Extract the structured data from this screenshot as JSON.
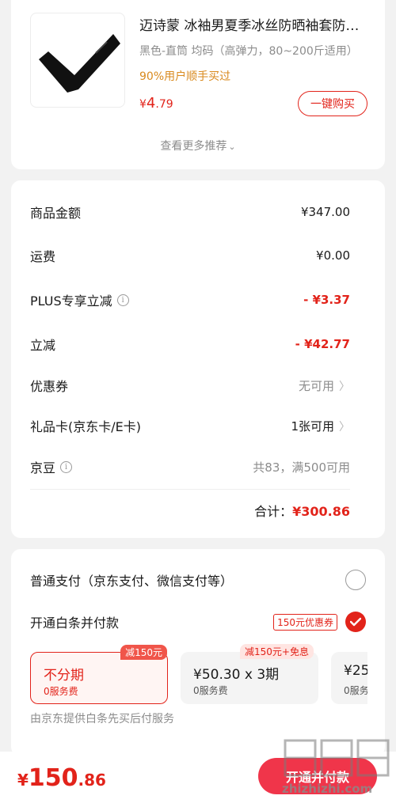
{
  "recommend": {
    "product_title": "迈诗蒙 冰袖男夏季冰丝防晒袖套防紫外线运动",
    "product_spec": "黑色-直筒   均码（高弹力，80~200斤适用）",
    "social_proof": "90%用户顺手买过",
    "price_currency": "¥",
    "price_int": "4",
    "price_dec": ".79",
    "buy_label": "一键购买",
    "more_label": "查看更多推荐"
  },
  "summary": {
    "rows": [
      {
        "label": "商品金额",
        "value": "¥347.00"
      },
      {
        "label": "运费",
        "value": "¥0.00"
      },
      {
        "label": "PLUS专享立减",
        "value": "- ¥3.37"
      },
      {
        "label": "立减",
        "value": "- ¥42.77"
      },
      {
        "label": "优惠券",
        "value": "无可用"
      },
      {
        "label": "礼品卡(京东卡/E卡)",
        "value": "1张可用"
      },
      {
        "label": "京豆",
        "value": "共83，满500可用"
      }
    ],
    "total_label": "合计：",
    "total_amount": "¥300.86"
  },
  "payment": {
    "normal_label": "普通支付（京东支付、微信支付等）",
    "baitiao_label": "开通白条并付款",
    "coupon_tag": "150元优惠券",
    "plans": [
      {
        "title": "不分期",
        "fee": "0服务费",
        "tag": "减150元"
      },
      {
        "title": "¥50.30 x 3期",
        "fee": "0服务费",
        "tag": "减150元+免息"
      },
      {
        "title": "¥25",
        "fee": "0服务"
      }
    ],
    "note": "由京东提供白条先买后付服务"
  },
  "bottom": {
    "currency": "¥",
    "amount_int": "150",
    "amount_dec": ".86",
    "submit_label": "开通并付款"
  },
  "watermark": {
    "glyphs": "值",
    "text": "zhizhizhi.com"
  },
  "colors": {
    "accent": "#e2231a",
    "gold": "#d98a1e",
    "background": "#f2f2f2"
  }
}
